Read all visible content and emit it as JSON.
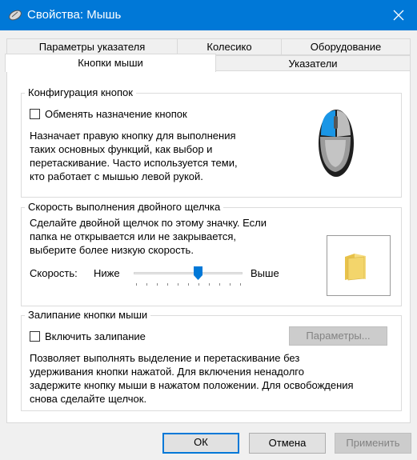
{
  "window": {
    "title": "Свойства: Мышь",
    "accent_color": "#0078d7",
    "icon": "mouse-icon"
  },
  "tabs": {
    "row_back": [
      {
        "label": "Параметры указателя"
      },
      {
        "label": "Колесико"
      },
      {
        "label": "Оборудование"
      }
    ],
    "row_front": [
      {
        "label": "Кнопки мыши",
        "active": true
      },
      {
        "label": "Указатели",
        "active": false
      }
    ]
  },
  "button_config": {
    "title": "Конфигурация кнопок",
    "swap_checkbox_label": "Обменять назначение кнопок",
    "swap_checked": false,
    "description": [
      "Назначает правую кнопку для выполнения",
      "таких основных функций, как выбор и",
      "перетаскивание. Часто используется теми,",
      "кто работает с мышью левой рукой."
    ],
    "illustration": "mouse-illustration-icon"
  },
  "double_click": {
    "title": "Скорость выполнения двойного щелчка",
    "description": [
      "Сделайте двойной щелчок по этому значку. Если",
      "папка не открывается или не закрывается,",
      "выберите более низкую скорость."
    ],
    "speed_label": "Скорость:",
    "slow_label": "Ниже",
    "fast_label": "Выше",
    "speed_value": 0.6,
    "test_icon": "folder-icon"
  },
  "click_lock": {
    "title": "Залипание кнопки мыши",
    "checkbox_label": "Включить залипание",
    "checked": false,
    "settings_button": "Параметры...",
    "description": [
      "Позволяет выполнять выделение и перетаскивание без",
      "удерживания кнопки нажатой. Для включения ненадолго",
      "задержите кнопку мыши в нажатом положении. Для освобождения",
      "снова сделайте щелчок."
    ]
  },
  "footer": {
    "ok": "ОК",
    "cancel": "Отмена",
    "apply": "Применить"
  }
}
